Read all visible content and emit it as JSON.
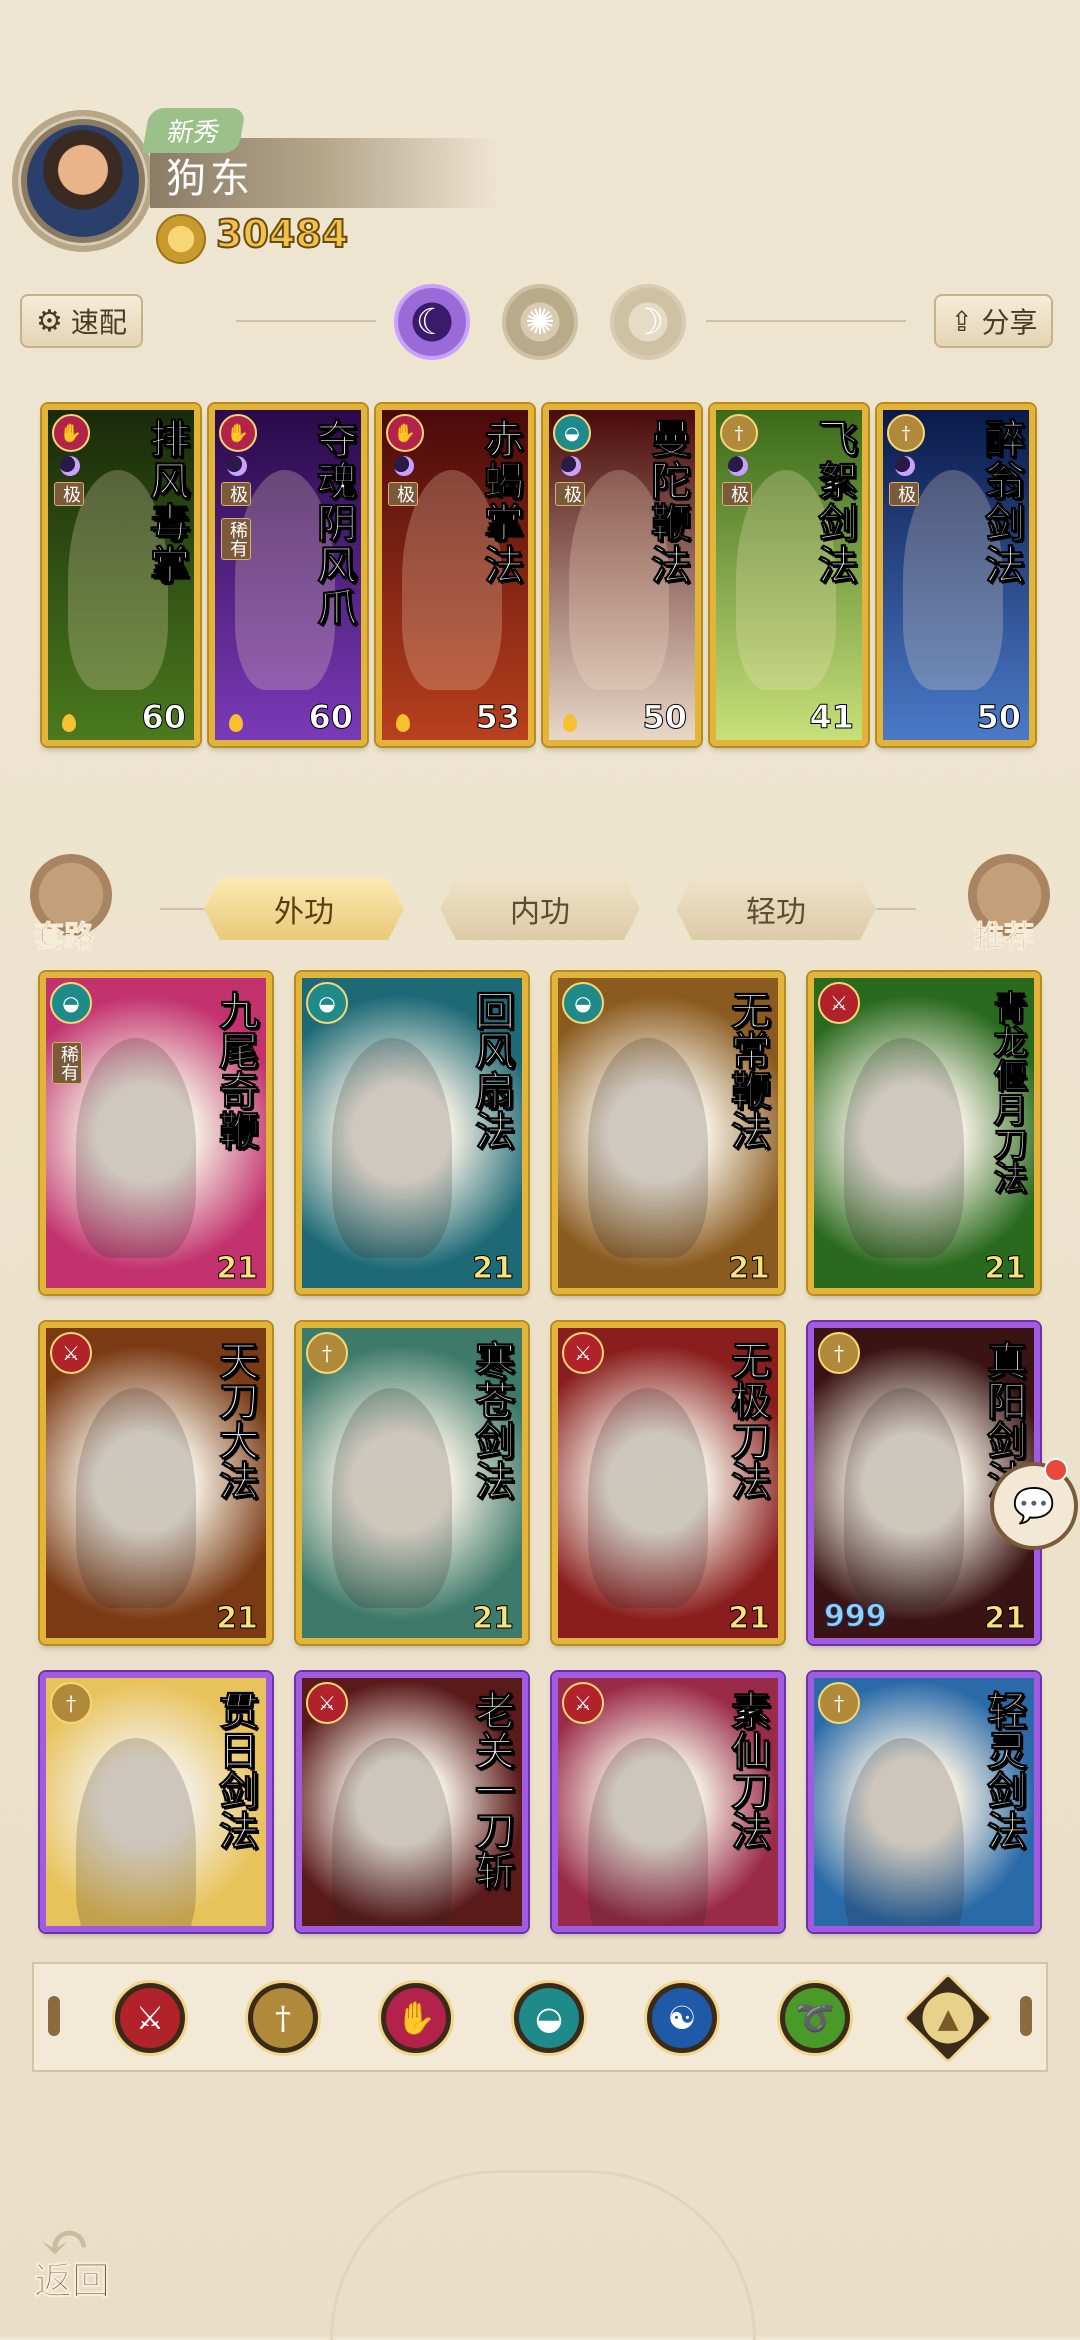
{
  "player": {
    "rank_badge": "新秀",
    "name": "狗东",
    "power": "30484"
  },
  "toolbar": {
    "quick_config_label": "速配",
    "share_label": "分享",
    "modes": [
      "moon-active",
      "sun",
      "crescent"
    ]
  },
  "equipped_skills": [
    {
      "title": "排风毒掌",
      "level": "60",
      "tag": "极",
      "rare": "",
      "emblem": "palm",
      "color": "#b2224a"
    },
    {
      "title": "夺魂阴风爪",
      "level": "60",
      "tag": "极",
      "rare": "稀有",
      "emblem": "palm",
      "color": "#b2224a"
    },
    {
      "title": "赤蝎掌法",
      "level": "53",
      "tag": "极",
      "rare": "",
      "emblem": "palm",
      "color": "#b2224a"
    },
    {
      "title": "曼陀鞭法",
      "level": "50",
      "tag": "极",
      "rare": "",
      "emblem": "fan",
      "color": "#1f8a8a"
    },
    {
      "title": "飞絮剑法",
      "level": "41",
      "tag": "极",
      "rare": "",
      "emblem": "sword",
      "color": "#b08a3a"
    },
    {
      "title": "醉翁剑法",
      "level": "50",
      "tag": "极",
      "rare": "",
      "emblem": "sword",
      "color": "#b08a3a"
    }
  ],
  "category": {
    "left_label": "套路",
    "right_label": "推荐",
    "tabs": [
      "外功",
      "内功",
      "轻功"
    ]
  },
  "skill_grid": [
    {
      "title": "九尾奇鞭",
      "level": "21",
      "rare": "稀有",
      "emblem": "fan",
      "color": "#1f8a8a",
      "bg": "#c2326e",
      "frame": "gold"
    },
    {
      "title": "回风扇法",
      "level": "21",
      "rare": "",
      "emblem": "fan",
      "color": "#1f8a8a",
      "bg": "#1d6a76",
      "frame": "gold"
    },
    {
      "title": "无常鞭法",
      "level": "21",
      "rare": "",
      "emblem": "fan",
      "color": "#1f8a8a",
      "bg": "#8a5a1e",
      "frame": "gold"
    },
    {
      "title": "青龙偃月刀法",
      "level": "21",
      "rare": "",
      "emblem": "blade",
      "color": "#b2222a",
      "bg": "#2a6a1e",
      "frame": "gold"
    },
    {
      "title": "天刀大法",
      "level": "21",
      "rare": "",
      "emblem": "blade",
      "color": "#b2222a",
      "bg": "#7a3a14",
      "frame": "gold"
    },
    {
      "title": "寒苍剑法",
      "level": "21",
      "rare": "",
      "emblem": "sword",
      "color": "#b08a3a",
      "bg": "#3e7a6a",
      "frame": "gold"
    },
    {
      "title": "无极刀法",
      "level": "21",
      "rare": "",
      "emblem": "blade",
      "color": "#b2222a",
      "bg": "#8a1e1e",
      "frame": "gold"
    },
    {
      "title": "真阳剑法",
      "level": "21",
      "rare": "",
      "emblem": "sword",
      "color": "#b08a3a",
      "bg": "#3a1414",
      "frame": "purple",
      "stars": "999"
    },
    {
      "title": "贯日剑法",
      "level": "",
      "rare": "",
      "emblem": "sword",
      "color": "#b08a3a",
      "bg": "#e8c25a",
      "frame": "purple"
    },
    {
      "title": "老关一刀斩",
      "level": "",
      "rare": "",
      "emblem": "blade",
      "color": "#b2222a",
      "bg": "#5a1a1a",
      "frame": "purple"
    },
    {
      "title": "素仙刀法",
      "level": "",
      "rare": "",
      "emblem": "blade",
      "color": "#b2222a",
      "bg": "#9a2a4a",
      "frame": "purple"
    },
    {
      "title": "轻灵剑法",
      "level": "",
      "rare": "",
      "emblem": "sword",
      "color": "#b08a3a",
      "bg": "#2a6aa8",
      "frame": "purple"
    }
  ],
  "filters": [
    {
      "name": "blade-filter-icon",
      "color": "#b2222a",
      "glyph": "⚔"
    },
    {
      "name": "sword-filter-icon",
      "color": "#b08a3a",
      "glyph": "†"
    },
    {
      "name": "palm-filter-icon",
      "color": "#b2224a",
      "glyph": "✋"
    },
    {
      "name": "fan-filter-icon",
      "color": "#1f8a8a",
      "glyph": "◒"
    },
    {
      "name": "taiji-filter-icon",
      "color": "#1f5aa8",
      "glyph": "☯"
    },
    {
      "name": "whip-filter-icon",
      "color": "#4a9a2a",
      "glyph": "➰"
    },
    {
      "name": "other-filter-icon",
      "color": "#e8d28a",
      "glyph": "▲"
    }
  ],
  "back_label": "返回"
}
